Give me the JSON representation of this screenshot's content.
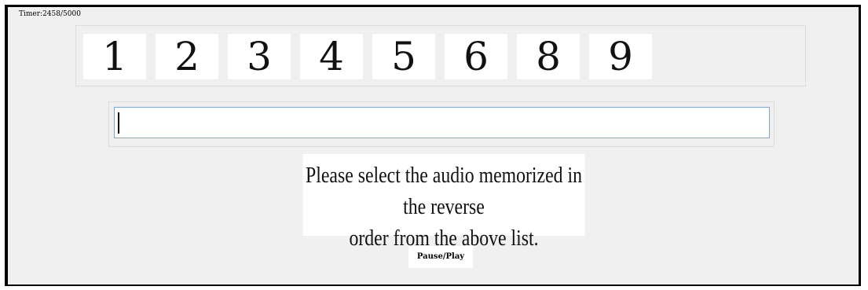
{
  "timer": {
    "label": "Timer:2458/5000"
  },
  "digits": [
    "1",
    "2",
    "3",
    "4",
    "5",
    "6",
    "8",
    "9"
  ],
  "answer_input": {
    "value": ""
  },
  "instruction": {
    "line1": "Please select the audio memorized in the reverse",
    "line2": "order from the above list."
  },
  "controls": {
    "pause_play_label": "Pause/Play"
  }
}
